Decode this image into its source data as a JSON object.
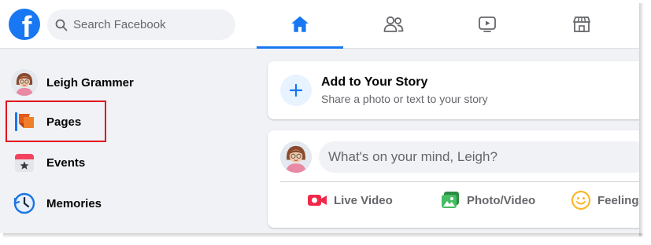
{
  "header": {
    "logo_letter": "f",
    "search_placeholder": "Search Facebook",
    "nav_tabs": [
      {
        "icon": "home-icon",
        "active": true
      },
      {
        "icon": "friends-icon",
        "active": false
      },
      {
        "icon": "watch-icon",
        "active": false
      },
      {
        "icon": "marketplace-icon",
        "active": false
      }
    ]
  },
  "sidebar": {
    "items": [
      {
        "label": "Leigh Grammer",
        "icon": "profile-avatar"
      },
      {
        "label": "Pages",
        "icon": "pages-flag-icon",
        "highlighted": true
      },
      {
        "label": "Events",
        "icon": "events-calendar-icon"
      },
      {
        "label": "Memories",
        "icon": "memories-clock-icon"
      }
    ]
  },
  "story": {
    "title": "Add to Your Story",
    "subtitle": "Share a photo or text to your story"
  },
  "composer": {
    "prompt": "What's on your mind, Leigh?",
    "actions": [
      {
        "label": "Live Video",
        "icon": "live-video-icon"
      },
      {
        "label": "Photo/Video",
        "icon": "photo-video-icon"
      },
      {
        "label": "Feeling/",
        "icon": "feeling-icon"
      }
    ]
  },
  "colors": {
    "brand": "#1877f2",
    "highlight_box": "#e0121b",
    "live_red": "#f02849",
    "photo_green": "#45bd62",
    "feeling_yellow": "#f7b928"
  }
}
